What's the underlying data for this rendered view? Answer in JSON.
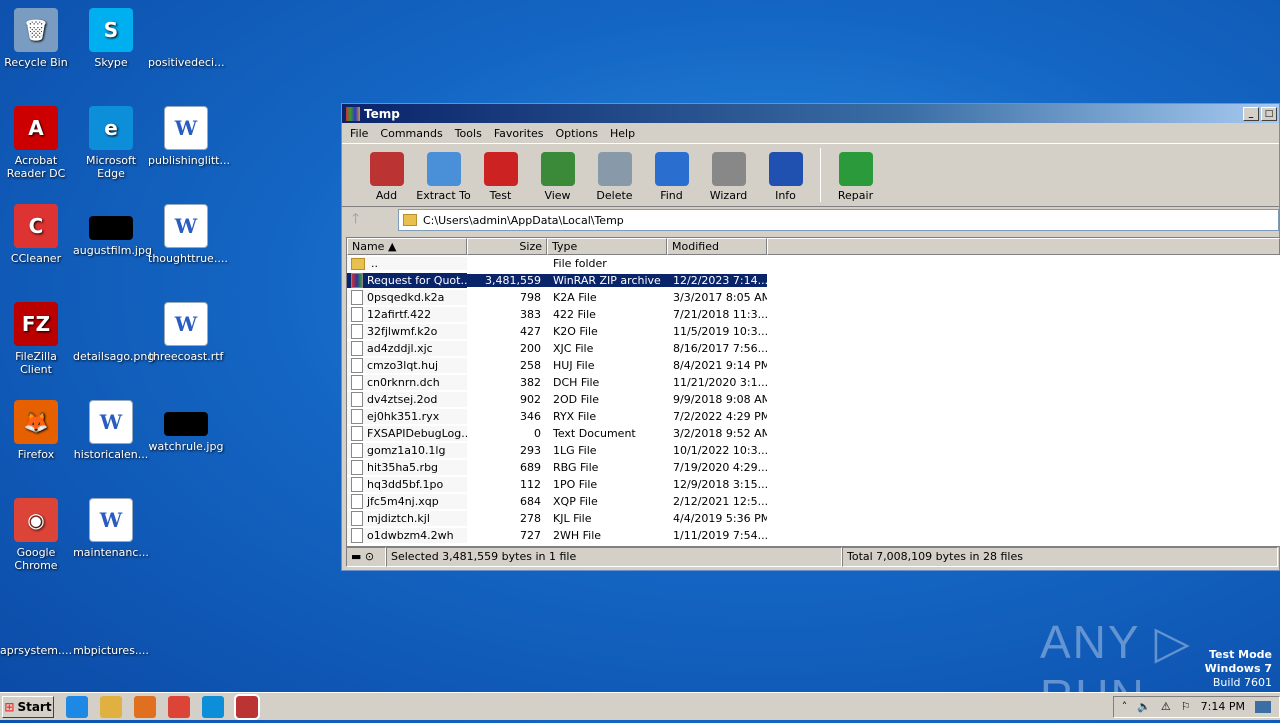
{
  "desktop": {
    "icons": [
      {
        "label": "Recycle Bin",
        "color": "#7a9cc0",
        "glyph": "🗑",
        "col": 0,
        "row": 0
      },
      {
        "label": "Skype",
        "color": "#00aff0",
        "glyph": "S",
        "col": 1,
        "row": 0
      },
      {
        "label": "positivedeci...",
        "color": "",
        "glyph": "",
        "col": 2,
        "row": 0
      },
      {
        "label": "Acrobat Reader DC",
        "color": "#c00",
        "glyph": "A",
        "col": 0,
        "row": 1
      },
      {
        "label": "Microsoft Edge",
        "color": "#0c8ed9",
        "glyph": "e",
        "col": 1,
        "row": 1
      },
      {
        "label": "publishinglitt...",
        "color": "doc",
        "glyph": "W",
        "col": 2,
        "row": 1
      },
      {
        "label": "CCleaner",
        "color": "#d33",
        "glyph": "C",
        "col": 0,
        "row": 2
      },
      {
        "label": "augustfilm.jpg",
        "color": "black",
        "glyph": "",
        "col": 1,
        "row": 2
      },
      {
        "label": "thoughttrue....",
        "color": "doc",
        "glyph": "W",
        "col": 2,
        "row": 2
      },
      {
        "label": "FileZilla Client",
        "color": "#b00",
        "glyph": "FZ",
        "col": 0,
        "row": 3
      },
      {
        "label": "detailsago.png",
        "color": "",
        "glyph": "",
        "col": 1,
        "row": 3
      },
      {
        "label": "threecoast.rtf",
        "color": "doc",
        "glyph": "W",
        "col": 2,
        "row": 3
      },
      {
        "label": "Firefox",
        "color": "#e66000",
        "glyph": "🦊",
        "col": 0,
        "row": 4
      },
      {
        "label": "historicalen...",
        "color": "doc",
        "glyph": "W",
        "col": 1,
        "row": 4
      },
      {
        "label": "watchrule.jpg",
        "color": "black",
        "glyph": "",
        "col": 2,
        "row": 4
      },
      {
        "label": "Google Chrome",
        "color": "#db4437",
        "glyph": "◉",
        "col": 0,
        "row": 5
      },
      {
        "label": "maintenanc...",
        "color": "doc",
        "glyph": "W",
        "col": 1,
        "row": 5
      },
      {
        "label": "aprsystem....",
        "color": "",
        "glyph": "",
        "col": 0,
        "row": 6
      },
      {
        "label": "mbpictures....",
        "color": "",
        "glyph": "",
        "col": 1,
        "row": 6
      }
    ]
  },
  "window": {
    "title": "Temp",
    "menu": [
      "File",
      "Commands",
      "Tools",
      "Favorites",
      "Options",
      "Help"
    ],
    "toolbar": [
      {
        "label": "Add",
        "color": "#b33"
      },
      {
        "label": "Extract To",
        "color": "#4a90d9"
      },
      {
        "label": "Test",
        "color": "#c22"
      },
      {
        "label": "View",
        "color": "#3a8a3a"
      },
      {
        "label": "Delete",
        "color": "#8899aa"
      },
      {
        "label": "Find",
        "color": "#2a6fd0"
      },
      {
        "label": "Wizard",
        "color": "#888"
      },
      {
        "label": "Info",
        "color": "#2050b0"
      }
    ],
    "repair_label": "Repair",
    "path": "C:\\Users\\admin\\AppData\\Local\\Temp",
    "columns": [
      "Name",
      "Size",
      "Type",
      "Modified"
    ],
    "files": [
      {
        "name": "..",
        "size": "",
        "type": "File folder",
        "modified": "",
        "kind": "folder"
      },
      {
        "name": "Request for Quot...",
        "size": "3,481,559",
        "type": "WinRAR ZIP archive",
        "modified": "12/2/2023 7:14...",
        "kind": "zip",
        "selected": true
      },
      {
        "name": "0psqedkd.k2a",
        "size": "798",
        "type": "K2A File",
        "modified": "3/3/2017 8:05 AM"
      },
      {
        "name": "12afirtf.422",
        "size": "383",
        "type": "422 File",
        "modified": "7/21/2018 11:3..."
      },
      {
        "name": "32fjlwmf.k2o",
        "size": "427",
        "type": "K2O File",
        "modified": "11/5/2019 10:3..."
      },
      {
        "name": "ad4zddjl.xjc",
        "size": "200",
        "type": "XJC File",
        "modified": "8/16/2017 7:56..."
      },
      {
        "name": "cmzo3lqt.huj",
        "size": "258",
        "type": "HUJ File",
        "modified": "8/4/2021 9:14 PM"
      },
      {
        "name": "cn0rknrn.dch",
        "size": "382",
        "type": "DCH File",
        "modified": "11/21/2020 3:1..."
      },
      {
        "name": "dv4ztsej.2od",
        "size": "902",
        "type": "2OD File",
        "modified": "9/9/2018 9:08 AM"
      },
      {
        "name": "ej0hk351.ryx",
        "size": "346",
        "type": "RYX File",
        "modified": "7/2/2022 4:29 PM"
      },
      {
        "name": "FXSAPIDebugLog...",
        "size": "0",
        "type": "Text Document",
        "modified": "3/2/2018 9:52 AM"
      },
      {
        "name": "gomz1a10.1lg",
        "size": "293",
        "type": "1LG File",
        "modified": "10/1/2022 10:3..."
      },
      {
        "name": "hit35ha5.rbg",
        "size": "689",
        "type": "RBG File",
        "modified": "7/19/2020 4:29..."
      },
      {
        "name": "hq3dd5bf.1po",
        "size": "112",
        "type": "1PO File",
        "modified": "12/9/2018 3:15..."
      },
      {
        "name": "jfc5m4nj.xqp",
        "size": "684",
        "type": "XQP File",
        "modified": "2/12/2021 12:5..."
      },
      {
        "name": "mjdiztch.kjl",
        "size": "278",
        "type": "KJL File",
        "modified": "4/4/2019 5:36 PM"
      },
      {
        "name": "o1dwbzm4.2wh",
        "size": "727",
        "type": "2WH File",
        "modified": "1/11/2019 7:54..."
      }
    ],
    "status_left": "Selected 3,481,559 bytes in 1 file",
    "status_right": "Total 7,008,109 bytes in 28 files"
  },
  "taskbar": {
    "start": "Start",
    "clock": "7:14 PM",
    "apps": [
      "#1e88e5",
      "#e0b040",
      "#e07020",
      "#db4437",
      "#0c8ed9",
      "#b33"
    ]
  },
  "watermark": {
    "line1": "Test Mode",
    "line2": "Windows 7",
    "line3": "Build 7601",
    "brand": "ANY ▷ RUN"
  }
}
